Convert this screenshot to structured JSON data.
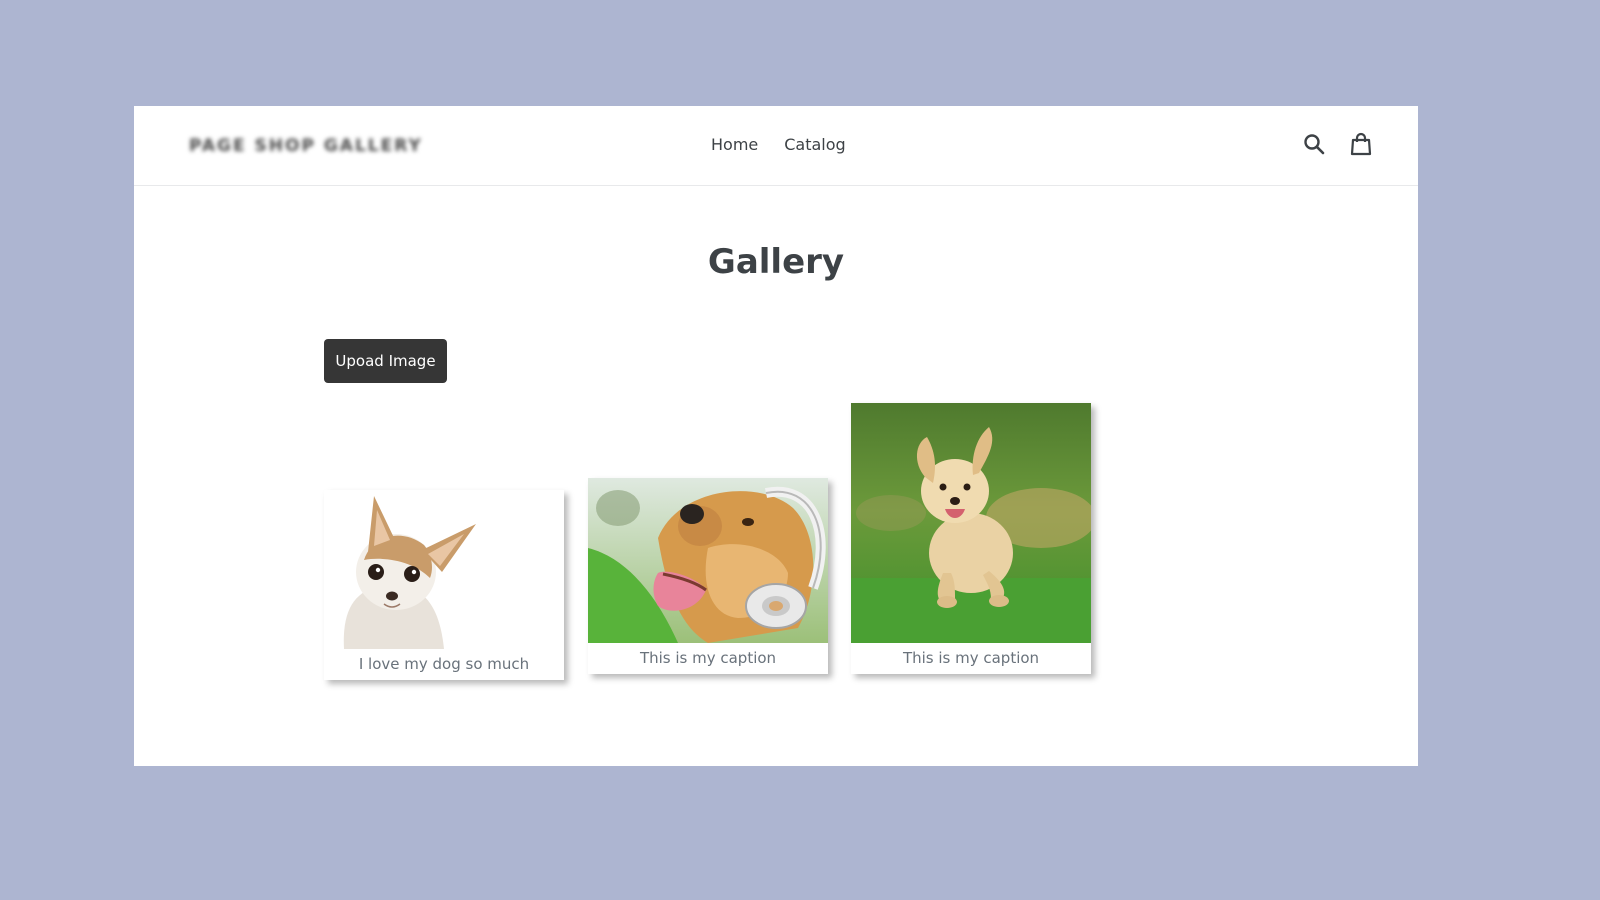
{
  "header": {
    "logo_text": "PAGE SHOP GALLERY",
    "nav": [
      {
        "label": "Home"
      },
      {
        "label": "Catalog"
      }
    ],
    "icons": [
      "search-icon",
      "cart-icon"
    ]
  },
  "main": {
    "title": "Gallery",
    "upload_label": "Upoad Image",
    "gallery": [
      {
        "caption": "I love my dog so much",
        "image": "chihuahua-photo"
      },
      {
        "caption": "This is my caption",
        "image": "golden-retriever-headphones-photo"
      },
      {
        "caption": "This is my caption",
        "image": "golden-puppy-running-photo"
      }
    ]
  },
  "colors": {
    "background": "#adb5d1",
    "button": "#363636",
    "text": "#3d4246",
    "caption": "#69727b"
  }
}
